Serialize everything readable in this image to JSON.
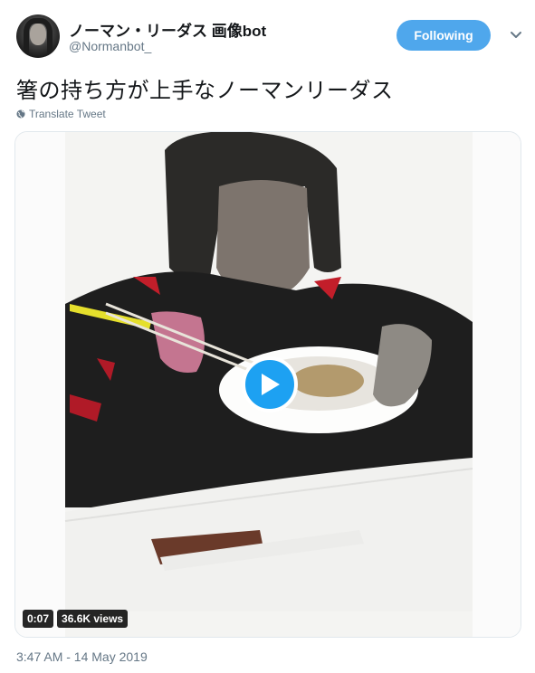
{
  "account": {
    "display_name": "ノーマン・リーダス 画像bot",
    "handle": "@Normanbot_",
    "avatar_icon": "profile-avatar"
  },
  "follow_button": {
    "label": "Following",
    "color": "#4fa7ec"
  },
  "menu_icon": "chevron-down-icon",
  "tweet": {
    "text": "箸の持ち方が上手なノーマンリーダス",
    "translate_label": "Translate Tweet",
    "timestamp": "3:47 AM - 14 May 2019"
  },
  "media": {
    "duration": "0:07",
    "views": "36.6K views",
    "play_icon": "play-icon",
    "accent": "#1da1f2"
  }
}
